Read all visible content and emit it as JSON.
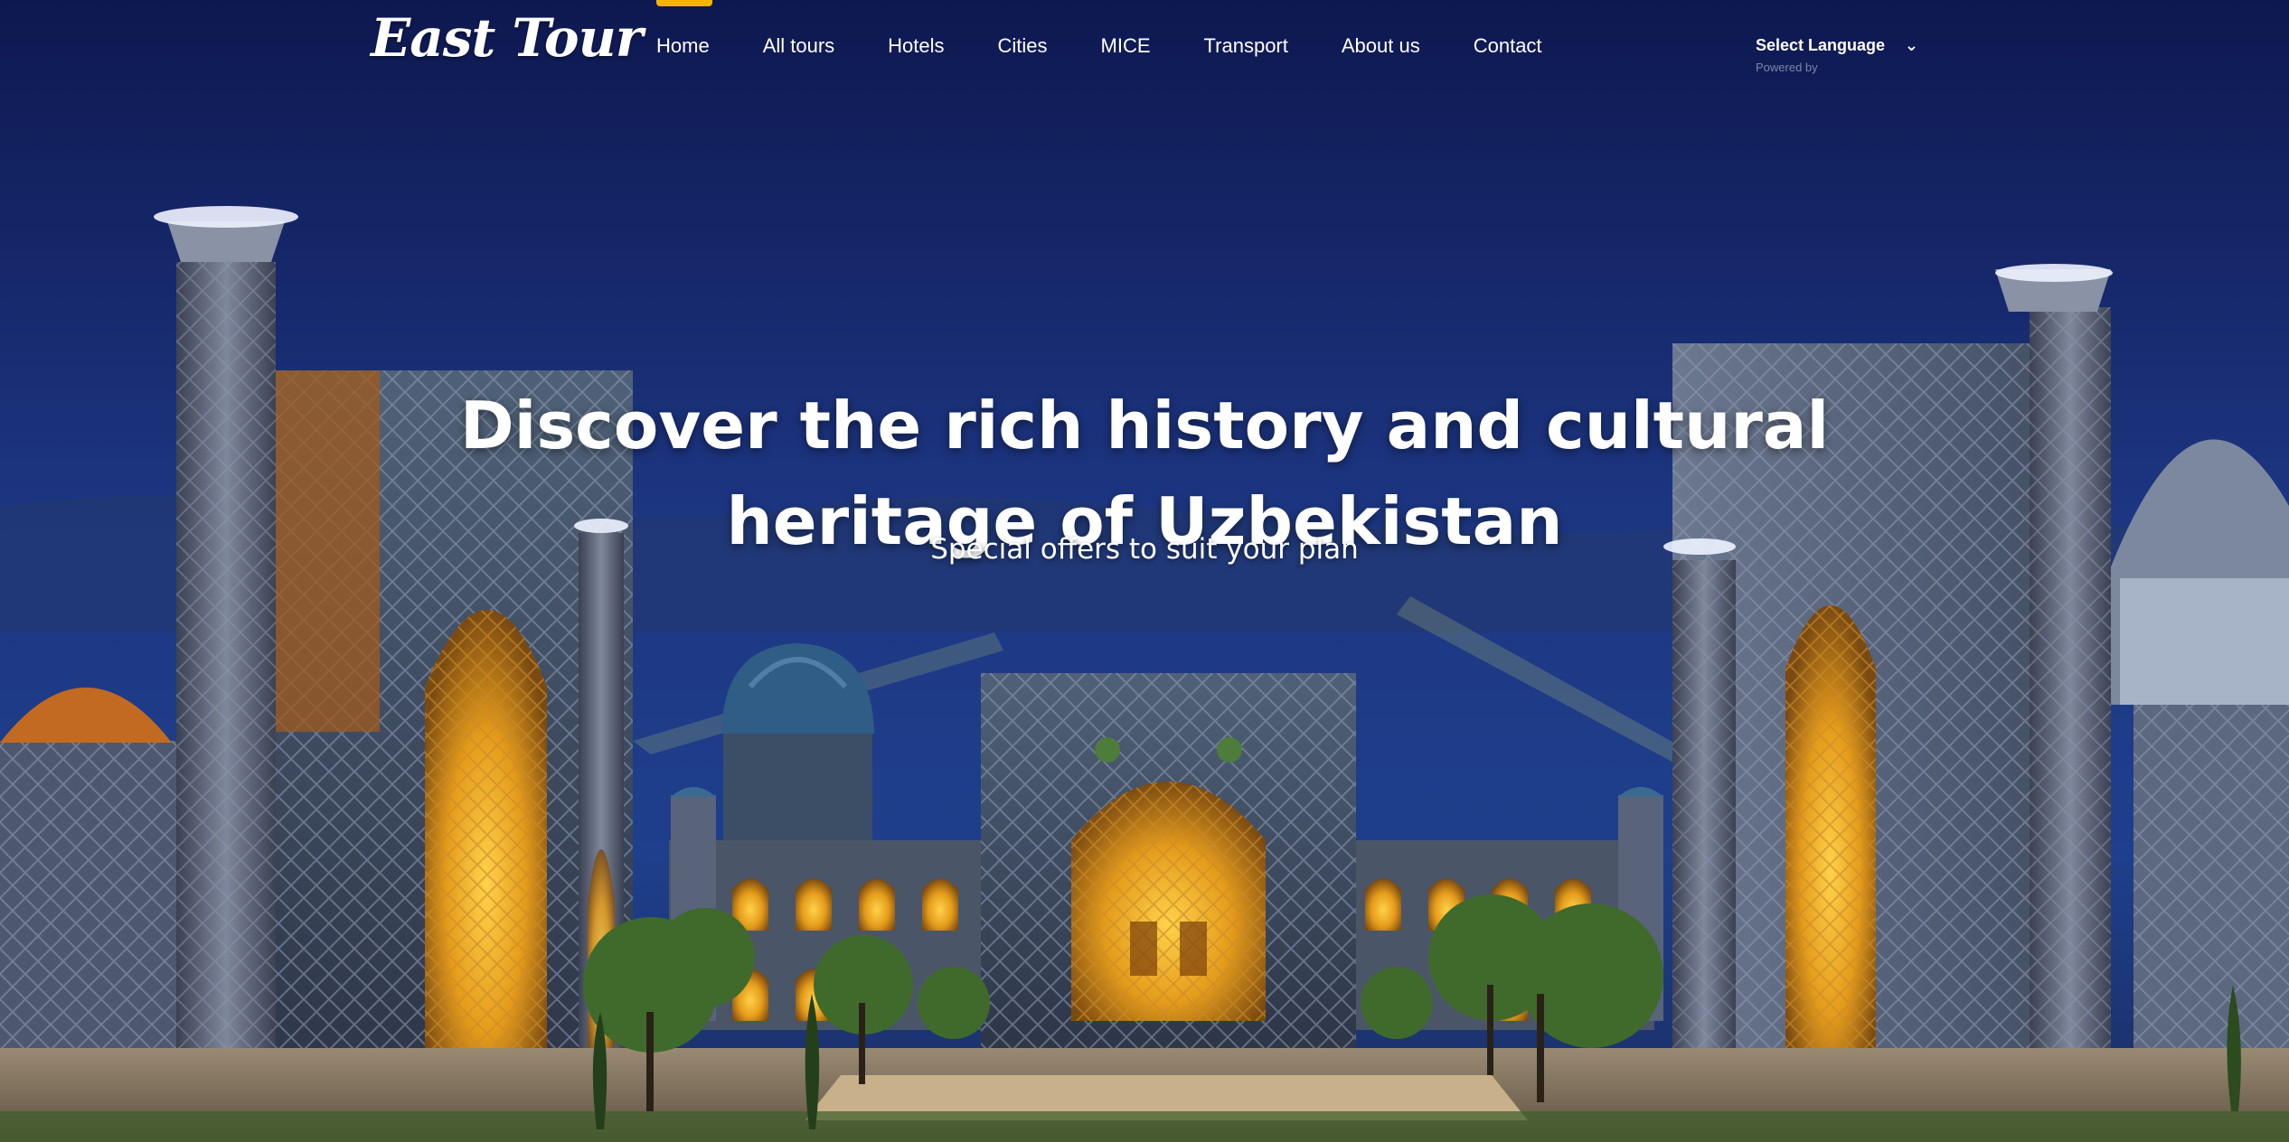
{
  "brand": {
    "logo_text": "East Tour",
    "accent_color": "#f5b400"
  },
  "nav": {
    "items": [
      {
        "label": "Home",
        "active": true
      },
      {
        "label": "All tours"
      },
      {
        "label": "Hotels"
      },
      {
        "label": "Cities"
      },
      {
        "label": "MICE"
      },
      {
        "label": "Transport"
      },
      {
        "label": "About us"
      },
      {
        "label": "Contact"
      }
    ]
  },
  "language": {
    "selected": "Select Language",
    "chevron_icon": "chevron-down-icon",
    "powered_by": "Powered by"
  },
  "hero": {
    "title_line1": "Discover the rich history and cultural",
    "title_line2": "heritage of Uzbekistan",
    "subtitle": "Special offers to suit your plan",
    "background": "night-view-registan-square-photo"
  }
}
